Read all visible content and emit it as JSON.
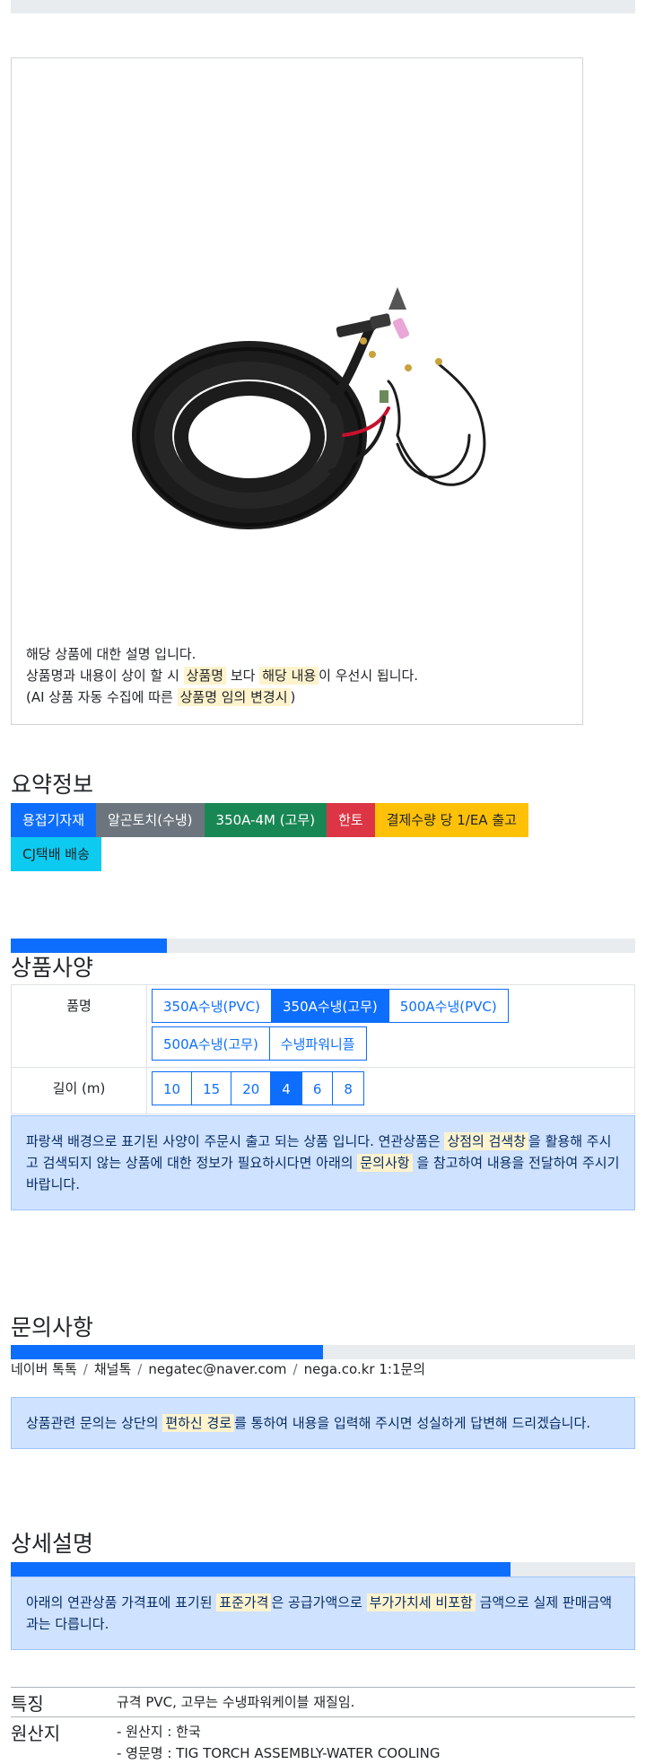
{
  "product": {
    "description_line1": "해당 상품에 대한 설명 입니다.",
    "description_line2_a": "상품명과 내용이 상이 할 시 ",
    "description_line2_hl1": "상품명",
    "description_line2_b": " 보다 ",
    "description_line2_hl2": "해당 내용",
    "description_line2_c": "이 우선시 됩니다.",
    "description_line3_a": "(AI 상품 자동 수집에 따른 ",
    "description_line3_hl": "상품명 임의 변경시",
    "description_line3_b": ")"
  },
  "summary": {
    "heading": "요약정보",
    "badges": [
      "용접기자재",
      "알곤토치(수냉)",
      "350A-4M (고무)",
      "한토",
      "결제수량 당 1/EA 출고",
      "CJ택배 배송"
    ]
  },
  "specs": {
    "heading": "상품사양",
    "progress_percent": 25,
    "name_label": "품명",
    "name_options": [
      "350A수냉(PVC)",
      "350A수냉(고무)",
      "500A수냉(PVC)",
      "500A수냉(고무)",
      "수냉파워니플"
    ],
    "name_selected": "350A수냉(고무)",
    "length_label": "길이 (m)",
    "length_options": [
      "10",
      "15",
      "20",
      "4",
      "6",
      "8"
    ],
    "length_selected": "4",
    "notice_a": "파랑색 배경으로 표기된 사양이 주문시 출고 되는 상품 입니다. 연관상품은 ",
    "notice_hl1": "상점의 검색창",
    "notice_b": "을 활용해 주시고 검색되지 않는 상품에 대한 정보가 필요하시다면 아래의 ",
    "notice_hl2": "문의사항",
    "notice_c": " 을 참고하여 내용을 전달하여 주시기 바랍니다."
  },
  "inquiry": {
    "heading": "문의사항",
    "progress_percent": 50,
    "links": [
      "네이버 톡톡",
      "채널톡",
      "negatec@naver.com",
      "nega.co.kr 1:1문의"
    ],
    "notice_a": "상품관련 문의는 상단의 ",
    "notice_hl": "편하신 경로",
    "notice_b": "를 통하여 내용을 입력해 주시면 성실하게 답변해 드리겠습니다."
  },
  "detail": {
    "heading": "상세설명",
    "progress_percent": 80,
    "notice_a": "아래의 연관상품 가격표에 표기된 ",
    "notice_hl1": "표준가격",
    "notice_b": "은 공급가액으로 ",
    "notice_hl2": "부가가치세 비포함",
    "notice_c": " 금액으로 실제 판매금액과는 다릅니다.",
    "feature_label": "특징",
    "feature_value": "규격 PVC, 고무는 수냉파워케이블 재질임.",
    "origin_label": "원산지",
    "origin_line1": "- 원산지 : 한국",
    "origin_line2": "- 영문명 : TIG TORCH ASSEMBLY-WATER COOLING"
  },
  "colors": {
    "primary": "#0d6efd",
    "secondary": "#6c757d",
    "success": "#198754",
    "danger": "#dc3545",
    "warning": "#ffc107",
    "info": "#0dcaf0",
    "highlight": "#fff3cd",
    "alert_bg": "#cfe2ff"
  }
}
